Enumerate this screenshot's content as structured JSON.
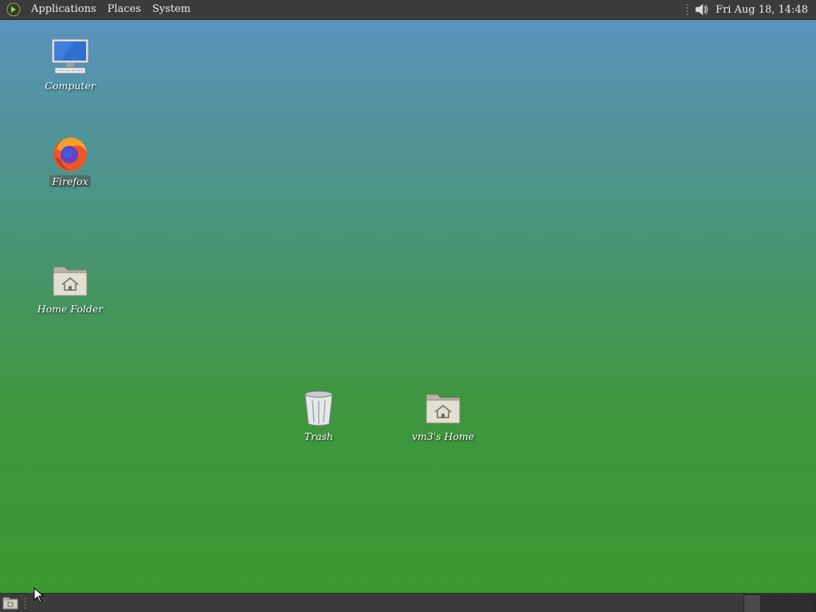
{
  "top_panel": {
    "menus": [
      "Applications",
      "Places",
      "System"
    ],
    "clock": "Fri Aug 18, 14:48",
    "logo_icon": "gnome-foot-icon",
    "volume_icon": "speaker-icon"
  },
  "desktop": {
    "icons": [
      {
        "label": "Computer",
        "icon": "computer-icon"
      },
      {
        "label": "Firefox",
        "icon": "firefox-icon"
      },
      {
        "label": "Home Folder",
        "icon": "home-folder-icon"
      },
      {
        "label": "Trash",
        "icon": "trash-icon"
      },
      {
        "label": "vm3's Home",
        "icon": "home-folder-icon"
      }
    ]
  },
  "bottom_panel": {
    "show_desktop_icon": "show-desktop-icon",
    "workspace_count": 4
  },
  "colors": {
    "panel": "#3b3b3b",
    "desktop_top": "#5a93c4",
    "desktop_bottom": "#3a9a2f",
    "text": "#ffffff"
  }
}
